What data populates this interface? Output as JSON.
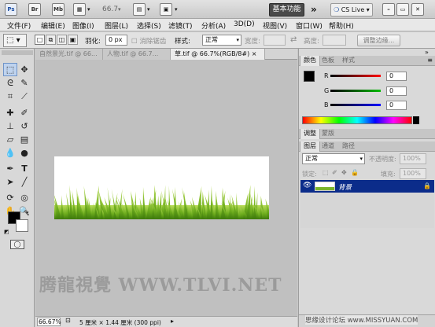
{
  "appbar": {
    "ps": "Ps",
    "br": "Br",
    "mb": "Mb",
    "zoom": "66.7",
    "workspace": "基本功能",
    "cslive": "CS Live"
  },
  "menu": [
    "文件(F)",
    "编辑(E)",
    "图像(I)",
    "图层(L)",
    "选择(S)",
    "滤镜(T)",
    "分析(A)",
    "3D(D)",
    "视图(V)",
    "窗口(W)",
    "帮助(H)"
  ],
  "options": {
    "feather_label": "羽化:",
    "feather_value": "0 px",
    "antialias_label": "消除锯齿",
    "style_label": "样式:",
    "style_value": "正常",
    "width_label": "宽度:",
    "height_label": "高度:",
    "refine_button": "调整边缘..."
  },
  "tabs": [
    "自然景光.tif @ 66...",
    "人物.tif @ 66.7...",
    "草.tif @ 66.7%(RGB/8#)"
  ],
  "color_panel": {
    "tabs": [
      "颜色",
      "色板",
      "样式"
    ],
    "r_label": "R",
    "g_label": "G",
    "b_label": "B",
    "r_value": "0",
    "g_value": "0",
    "b_value": "0"
  },
  "adjust_panel": {
    "tabs": [
      "调整",
      "蒙版"
    ]
  },
  "layers_panel": {
    "tabs": [
      "图层",
      "通道",
      "路径"
    ],
    "blend_mode": "正常",
    "opacity_label": "不透明度:",
    "opacity_value": "100%",
    "lock_label": "锁定:",
    "fill_label": "填充:",
    "fill_value": "100%",
    "layer_name": "背景"
  },
  "status": {
    "zoom": "66.67%",
    "doc_info": "5 厘米 × 1.44 厘米 (300 ppi)"
  },
  "watermark": "腾龍視覺 WWW.TLVI.NET",
  "site_watermark": "思缘设计论坛  www.MISSYUAN.COM",
  "colors": {
    "accent": "#0b2c8a",
    "grass": "#6fae1e"
  }
}
